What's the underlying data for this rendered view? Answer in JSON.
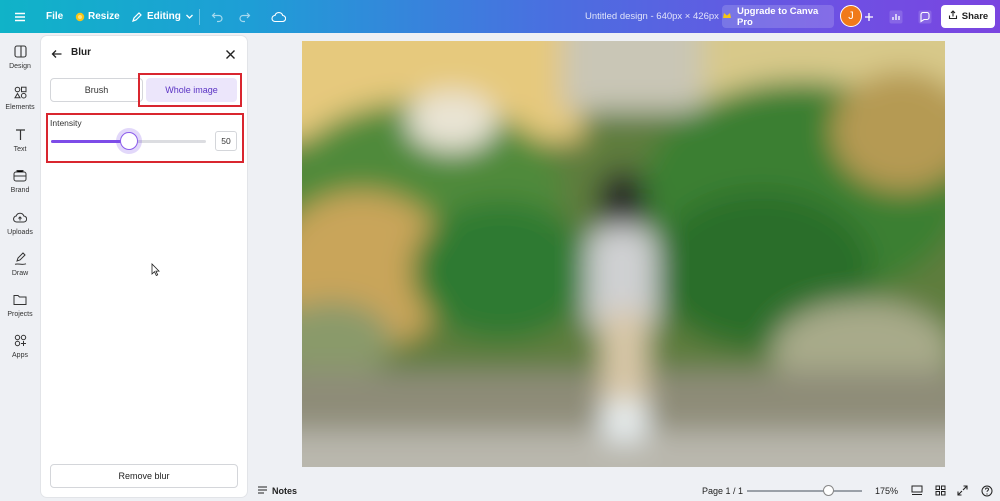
{
  "topbar": {
    "file_label": "File",
    "resize_label": "Resize",
    "editing_label": "Editing",
    "design_title": "Untitled design - 640px × 426px",
    "upgrade_label": "Upgrade to Canva Pro",
    "avatar_initial": "J",
    "share_label": "Share",
    "accent_start": "#10b3c8",
    "accent_end": "#7a45e0"
  },
  "rail": {
    "items": [
      {
        "label": "Design",
        "icon": "design-icon"
      },
      {
        "label": "Elements",
        "icon": "elements-icon"
      },
      {
        "label": "Text",
        "icon": "text-icon"
      },
      {
        "label": "Brand",
        "icon": "brand-icon"
      },
      {
        "label": "Uploads",
        "icon": "uploads-icon"
      },
      {
        "label": "Draw",
        "icon": "draw-icon"
      },
      {
        "label": "Projects",
        "icon": "projects-icon"
      },
      {
        "label": "Apps",
        "icon": "apps-icon"
      }
    ]
  },
  "panel": {
    "title": "Blur",
    "tabs": {
      "brush_label": "Brush",
      "whole_image_label": "Whole image",
      "selected": "Whole image"
    },
    "intensity": {
      "label": "Intensity",
      "value": "50",
      "fraction": 0.5
    },
    "remove_label": "Remove blur",
    "highlight_color": "#d9262f",
    "accent": "#7d4ce8"
  },
  "bottom": {
    "notes_label": "Notes",
    "page_indicator": "Page 1 / 1",
    "zoom": "175%"
  }
}
